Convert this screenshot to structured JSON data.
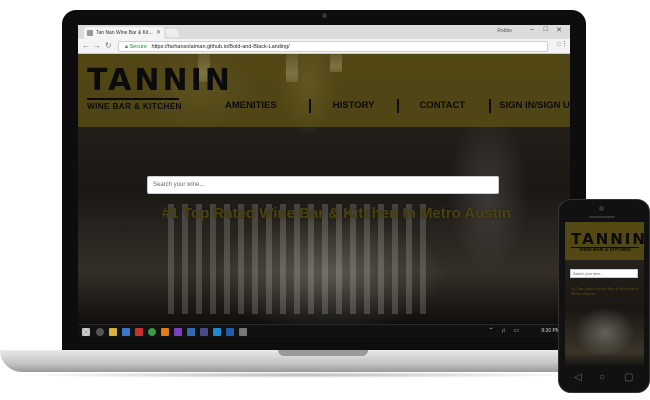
{
  "browser": {
    "tab_title": "Tan Nan Wine Bar & Kit...",
    "user": "Robbe",
    "window_controls": {
      "minimize": "–",
      "maximize": "□",
      "close": "✕"
    },
    "nav": {
      "back": "←",
      "forward": "→",
      "reload": "↻"
    },
    "secure_label": "Secure",
    "url": "https://farhansolaiman.github.io/Bold-and-Black-Landing/",
    "star_glyph": "☆",
    "menu_glyph": "⋮"
  },
  "site": {
    "logo_title": "TANNIN",
    "logo_subtitle": "WINE BAR & KITCHEN",
    "nav": [
      "AMENITIES",
      "HISTORY",
      "CONTACT",
      "SIGN IN/SIGN UP"
    ],
    "search_placeholder": "Search your wine...",
    "tagline": "#1 Top Rated Wine Bar & Kitchen In Metro Austin"
  },
  "taskbar": {
    "tray_glyphs": "⌃ ♫ ▭",
    "clock": "9:30 PM"
  },
  "phone": {
    "logo_title": "TANNIN",
    "logo_subtitle": "WINE BAR & KITCHEN",
    "search_placeholder": "Search your wine...",
    "tagline": "#1 Top Rated Wine Bar & Kitchen In Metro Austin",
    "nav_glyphs": {
      "back": "◁",
      "home": "○",
      "recent": "▢"
    }
  },
  "colors": {
    "header_overlay": "#5c4f12",
    "tagline": "#4c4211",
    "secure": "#1a8a2a"
  }
}
